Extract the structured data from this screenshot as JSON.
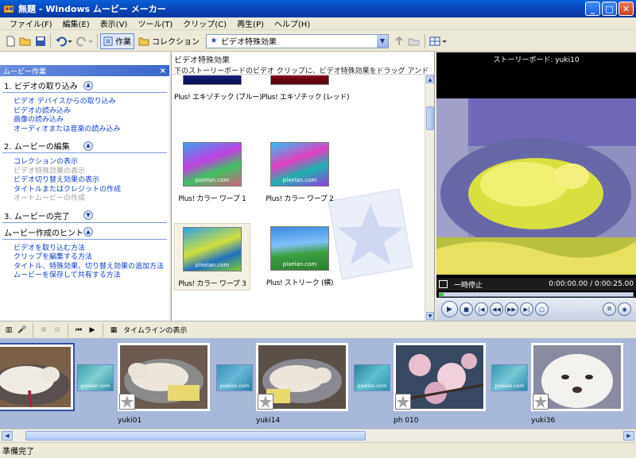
{
  "window": {
    "title": "無題 - Windows ムービー メーカー",
    "min": "_",
    "max": "□",
    "close": "✕"
  },
  "menu": [
    "ファイル(F)",
    "編集(E)",
    "表示(V)",
    "ツール(T)",
    "クリップ(C)",
    "再生(P)",
    "ヘルプ(H)"
  ],
  "toolbar": {
    "tasks_label": "作業",
    "collections_label": "コレクション",
    "collection_selected": "ビデオ特殊効果"
  },
  "taskpane": {
    "header": "ムービー作業",
    "sections": [
      {
        "title": "1. ビデオの取り込み",
        "chevron": "up",
        "links": [
          {
            "label": "ビデオ デバイスからの取り込み",
            "disabled": false
          },
          {
            "label": "ビデオの読み込み",
            "disabled": false
          },
          {
            "label": "画像の読み込み",
            "disabled": false
          },
          {
            "label": "オーディオまたは音楽の読み込み",
            "disabled": false
          }
        ]
      },
      {
        "title": "2. ムービーの編集",
        "chevron": "up",
        "links": [
          {
            "label": "コレクションの表示",
            "disabled": false
          },
          {
            "label": "ビデオ特殊効果の表示",
            "disabled": true
          },
          {
            "label": "ビデオ切り替え効果の表示",
            "disabled": false
          },
          {
            "label": "タイトルまたはクレジットの作成",
            "disabled": false
          },
          {
            "label": "オートムービーの作成",
            "disabled": true
          }
        ]
      },
      {
        "title": "3. ムービーの完了",
        "chevron": "down",
        "links": []
      },
      {
        "title": "ムービー作成のヒント",
        "chevron": "up",
        "links": [
          {
            "label": "ビデオを取り込む方法",
            "disabled": false
          },
          {
            "label": "クリップを編集する方法",
            "disabled": false
          },
          {
            "label": "タイトル、特殊効果、切り替え効果の追加方法",
            "disabled": false
          },
          {
            "label": "ムービーを保存して共有する方法",
            "disabled": false
          }
        ]
      }
    ]
  },
  "content": {
    "title": "ビデオ特殊効果",
    "subtitle": "下のストーリーボードのビデオ クリップに、ビデオ特殊効果をドラッグ アンド ドロップしてください。",
    "effects": [
      {
        "name": "Plus! エキゾチック (ブルー)",
        "thumb": "blue",
        "watermark": "",
        "selected": false
      },
      {
        "name": "Plus! エキゾチック (レッド)",
        "thumb": "red",
        "watermark": "",
        "selected": false
      },
      {
        "name": "Plus! カラー ワープ 1",
        "thumb": "warp1",
        "watermark": "pixelan.com",
        "selected": false
      },
      {
        "name": "Plus! カラー ワープ 2",
        "thumb": "warp2",
        "watermark": "pixelan.com",
        "selected": false
      },
      {
        "name": "Plus! カラー ワープ 3",
        "thumb": "warp3",
        "watermark": "pixelan.com",
        "selected": true
      },
      {
        "name": "Plus! ストリーク (横)",
        "thumb": "streak",
        "watermark": "pixelan.com",
        "selected": false
      }
    ]
  },
  "preview": {
    "title": "ストーリーボード: yuki10",
    "status": "一時停止",
    "time": "0:00:00.00 / 0:00:25.00",
    "progress": 0.02
  },
  "storyboard": {
    "toolbar_label": "タイムラインの表示",
    "clips": [
      {
        "name": "",
        "scene": "dog1"
      },
      {
        "name": "yuki01",
        "scene": "dog2"
      },
      {
        "name": "yuki14",
        "scene": "dog3"
      },
      {
        "name": "ph 010",
        "scene": "blossom"
      },
      {
        "name": "yuki36",
        "scene": "dog4"
      }
    ],
    "transition_label": "pixelan.com"
  },
  "statusbar": {
    "text": "準備完了"
  }
}
